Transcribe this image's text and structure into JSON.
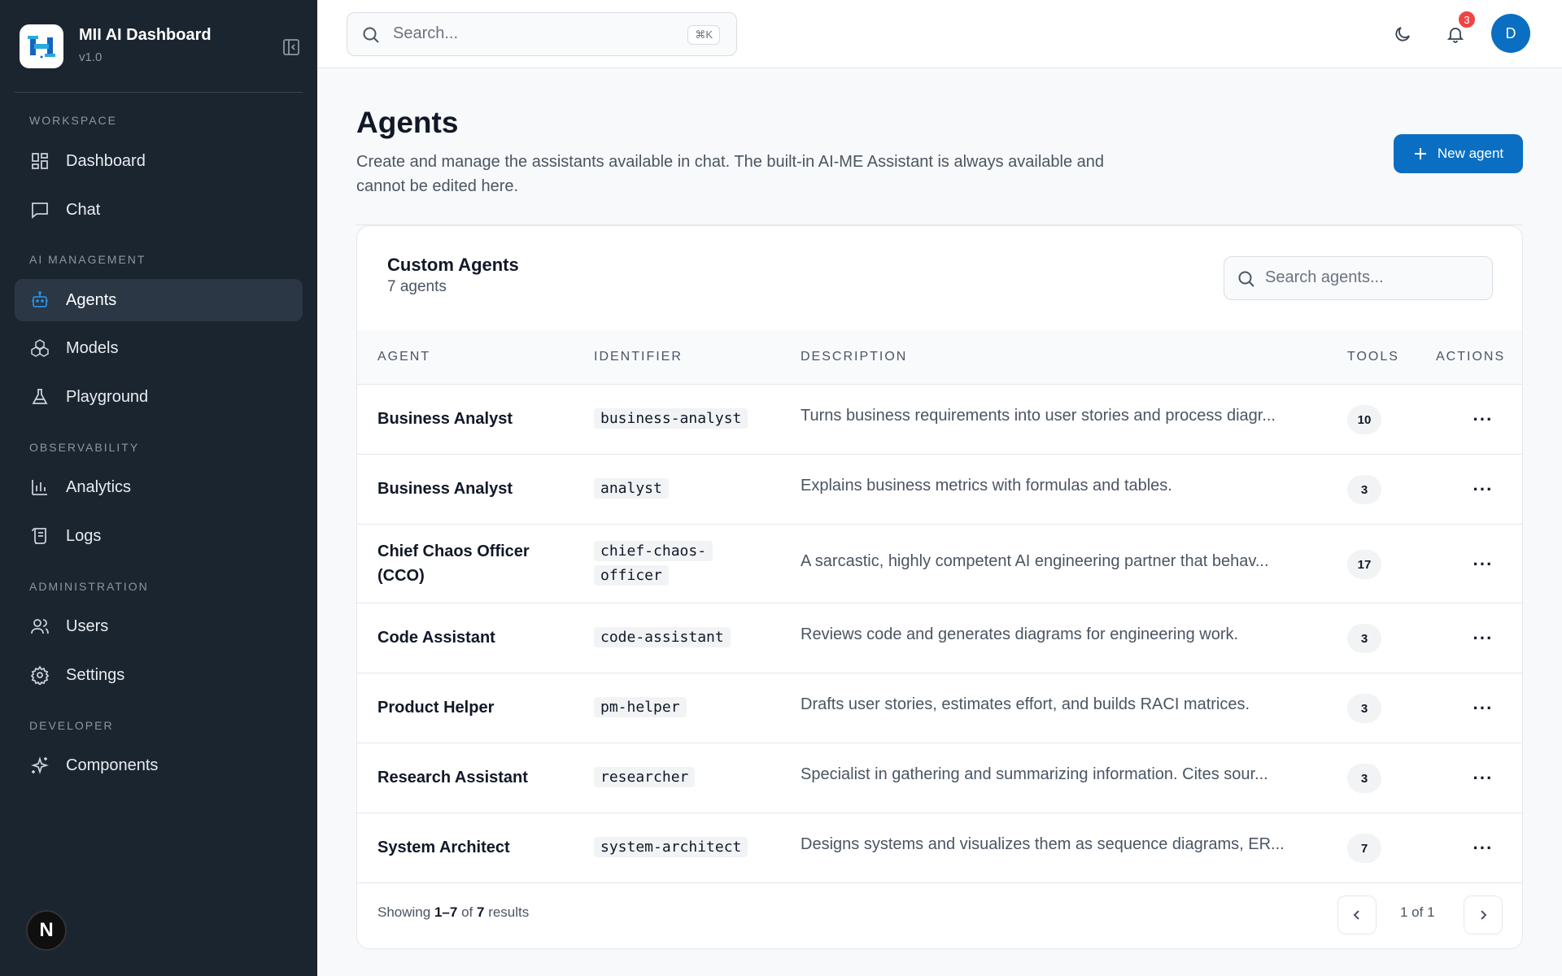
{
  "sidebar": {
    "brand_title": "MII AI Dashboard",
    "brand_version": "v1.0",
    "sections": [
      {
        "label": "WORKSPACE"
      },
      {
        "label": "AI MANAGEMENT"
      },
      {
        "label": "OBSERVABILITY"
      },
      {
        "label": "ADMINISTRATION"
      },
      {
        "label": "DEVELOPER"
      }
    ],
    "items": [
      {
        "label": "Dashboard",
        "icon": "dashboard-grid-icon"
      },
      {
        "label": "Chat",
        "icon": "chat-bubble-icon"
      },
      {
        "label": "Agents",
        "icon": "robot-icon",
        "active": true
      },
      {
        "label": "Models",
        "icon": "cubes-icon"
      },
      {
        "label": "Playground",
        "icon": "flask-icon"
      },
      {
        "label": "Analytics",
        "icon": "bar-chart-icon"
      },
      {
        "label": "Logs",
        "icon": "scroll-icon"
      },
      {
        "label": "Users",
        "icon": "users-icon"
      },
      {
        "label": "Settings",
        "icon": "gear-icon"
      },
      {
        "label": "Components",
        "icon": "sparkles-icon"
      }
    ],
    "footer_badge": "N"
  },
  "topbar": {
    "search_placeholder": "Search...",
    "search_shortcut": "⌘K",
    "notifications_count": "3",
    "avatar_initial": "D"
  },
  "page": {
    "title": "Agents",
    "description": "Create and manage the assistants available in chat. The built-in AI-ME Assistant is always available and cannot be edited here.",
    "new_button_label": "New agent"
  },
  "card": {
    "title": "Custom Agents",
    "subtitle": "7 agents",
    "search_placeholder": "Search agents..."
  },
  "table": {
    "columns": [
      "AGENT",
      "IDENTIFIER",
      "DESCRIPTION",
      "TOOLS",
      "ACTIONS"
    ],
    "rows": [
      {
        "name": "Business Analyst",
        "identifier": "business-analyst",
        "description": "Turns business requirements into user stories and process diagr...",
        "tools": "10"
      },
      {
        "name": "Business Analyst",
        "identifier": "analyst",
        "description": "Explains business metrics with formulas and tables.",
        "tools": "3"
      },
      {
        "name": "Chief Chaos Officer (CCO)",
        "identifier": "chief-chaos-officer",
        "description": "A sarcastic, highly competent AI engineering partner that behav...",
        "tools": "17"
      },
      {
        "name": "Code Assistant",
        "identifier": "code-assistant",
        "description": "Reviews code and generates diagrams for engineering work.",
        "tools": "3"
      },
      {
        "name": "Product Helper",
        "identifier": "pm-helper",
        "description": "Drafts user stories, estimates effort, and builds RACI matrices.",
        "tools": "3"
      },
      {
        "name": "Research Assistant",
        "identifier": "researcher",
        "description": "Specialist in gathering and summarizing information. Cites sour...",
        "tools": "3"
      },
      {
        "name": "System Architect",
        "identifier": "system-architect",
        "description": "Designs systems and visualizes them as sequence diagrams, ER...",
        "tools": "7"
      }
    ]
  },
  "footer": {
    "showing_prefix": "Showing",
    "range": "1–7",
    "of_word": "of",
    "total": "7",
    "results_word": "results",
    "page_info": "1 of 1"
  },
  "colors": {
    "sidebar_bg": "#1b2530",
    "accent": "#0a6fc2",
    "badge": "#ef4444"
  }
}
